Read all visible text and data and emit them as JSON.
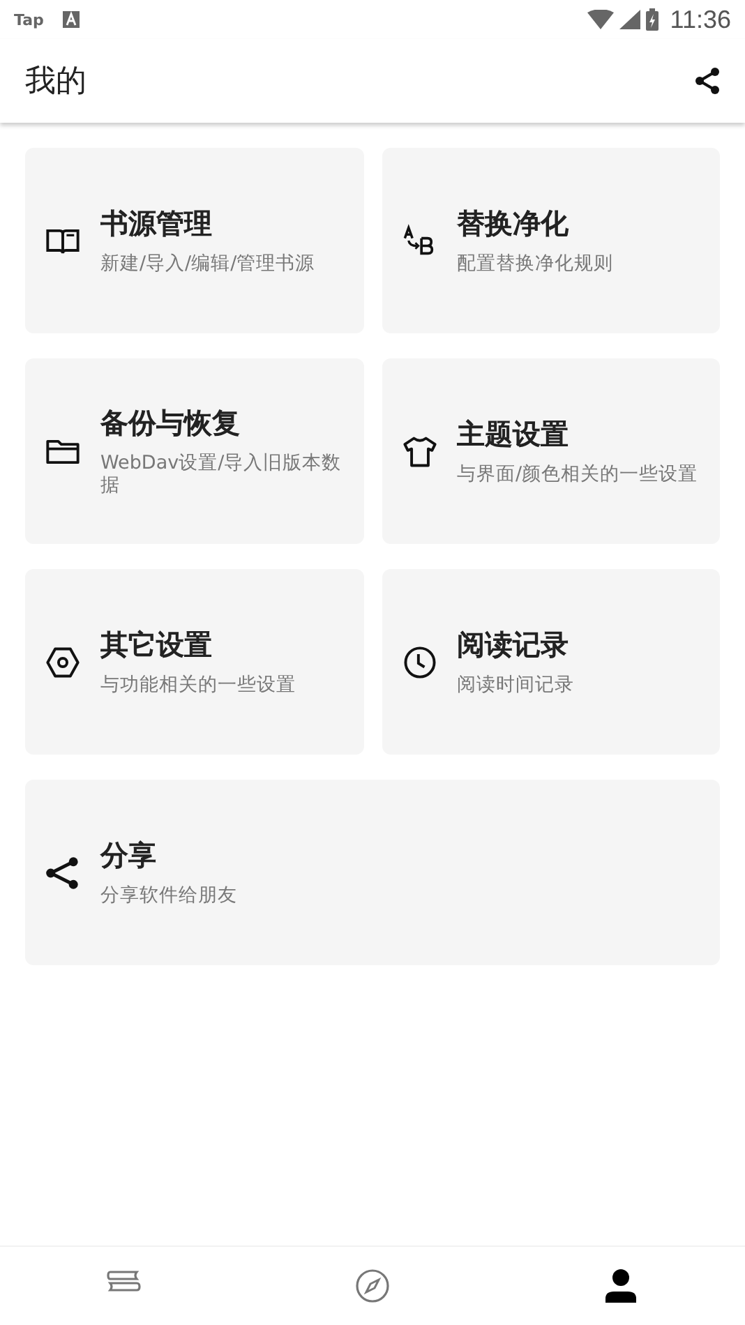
{
  "status_bar": {
    "app_label": "Tap",
    "time": "11:36"
  },
  "toolbar": {
    "title": "我的"
  },
  "cards": [
    {
      "title": "书源管理",
      "subtitle": "新建/导入/编辑/管理书源"
    },
    {
      "title": "替换净化",
      "subtitle": "配置替换净化规则"
    },
    {
      "title": "备份与恢复",
      "subtitle": "WebDav设置/导入旧版本数据"
    },
    {
      "title": "主题设置",
      "subtitle": "与界面/颜色相关的一些设置"
    },
    {
      "title": "其它设置",
      "subtitle": "与功能相关的一些设置"
    },
    {
      "title": "阅读记录",
      "subtitle": "阅读时间记录"
    },
    {
      "title": "分享",
      "subtitle": "分享软件给朋友"
    }
  ],
  "bottom_nav": [
    {
      "selected": false
    },
    {
      "selected": false
    },
    {
      "selected": true
    }
  ]
}
